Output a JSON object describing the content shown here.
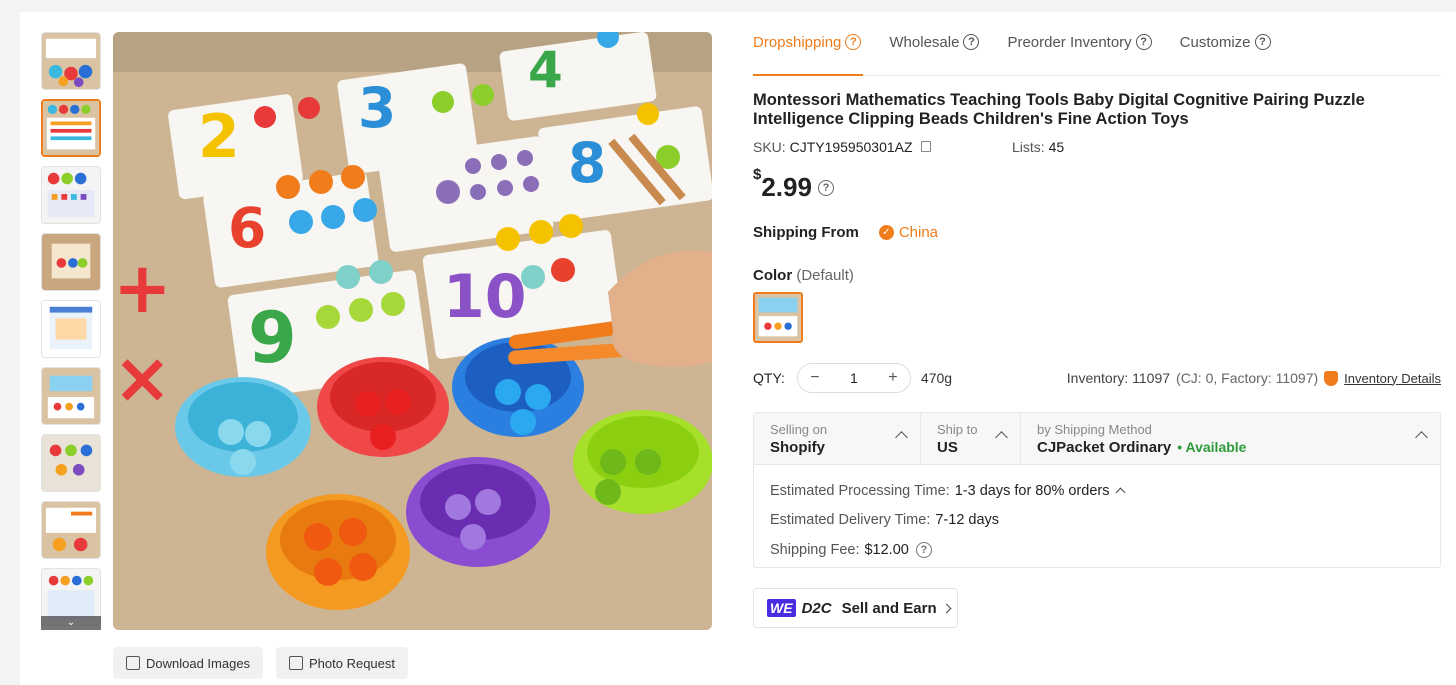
{
  "tabs": [
    {
      "label": "Dropshipping",
      "active": true
    },
    {
      "label": "Wholesale",
      "active": false
    },
    {
      "label": "Preorder Inventory",
      "active": false
    },
    {
      "label": "Customize",
      "active": false
    }
  ],
  "product": {
    "title": "Montessori Mathematics Teaching Tools Baby Digital Cognitive Pairing Puzzle Intelligence Clipping Beads Children's Fine Action Toys",
    "sku_label": "SKU:",
    "sku": "CJTY195950301AZ",
    "lists_label": "Lists:",
    "lists": "45",
    "currency": "$",
    "price": "2.99"
  },
  "shipping_from": {
    "label": "Shipping From",
    "value": "China"
  },
  "color": {
    "label": "Color",
    "value": "(Default)"
  },
  "qty": {
    "label": "QTY:",
    "minus": "−",
    "plus": "+",
    "value": "1",
    "weight": "470g"
  },
  "inventory": {
    "text": "Inventory: 11097",
    "detail": "(CJ: 0, Factory: 11097)",
    "link": "Inventory Details"
  },
  "ship_box": {
    "selling_on": {
      "label": "Selling on",
      "value": "Shopify"
    },
    "ship_to": {
      "label": "Ship to",
      "value": "US"
    },
    "method": {
      "label": "by Shipping Method",
      "value": "CJPacket Ordinary",
      "status": "• Available"
    },
    "processing": {
      "label": "Estimated Processing Time:",
      "value": "1-3 days for 80% orders"
    },
    "delivery": {
      "label": "Estimated Delivery Time:",
      "value": "7-12 days"
    },
    "fee": {
      "label": "Shipping Fee:",
      "value": "$12.00"
    }
  },
  "d2c": {
    "badge": "WE",
    "brand": "D2C",
    "label": "Sell and Earn"
  },
  "image_buttons": {
    "download": "Download Images",
    "photo": "Photo Request"
  },
  "thumbnails": [
    "thumb-1",
    "thumb-2",
    "thumb-3",
    "thumb-4",
    "thumb-5",
    "thumb-6",
    "thumb-7",
    "thumb-8",
    "thumb-9"
  ],
  "icons": {
    "help": "?",
    "more": "⌄",
    "check": "✓"
  },
  "colors": {
    "accent": "#f07c1c",
    "available": "#2e9b3a",
    "we_badge": "#4a2de0"
  }
}
